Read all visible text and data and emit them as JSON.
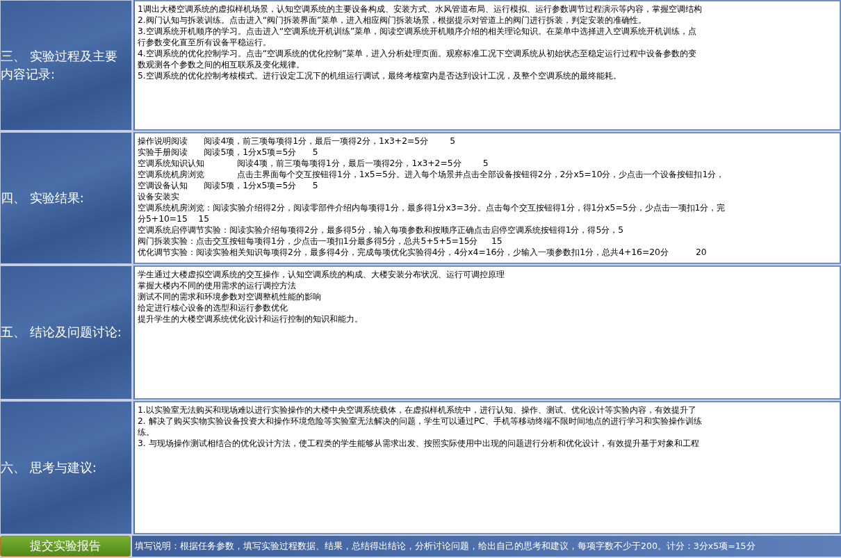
{
  "sections": [
    {
      "label": "三、 实验过程及主要内容记录:",
      "lines": [
        "1调出大楼空调系统的虚拟样机场景，认知空调系统的主要设备构成、安装方式、水风管道布局、运行模拟、运行参数调节过程演示等内容，掌握空调结构",
        "2.阀门认知与拆装训练。点击进入“阀门拆装界面”菜单，进入相应阀门拆装场景，根据提示对管道上的阀门进行拆装，判定安装的准确性。",
        "3.空调系统开机顺序的学习。点击进入“空调系统开机训练”菜单，阅读空调系统开机顺序介绍的相关理论知识。在菜单中选择进入空调系统开机训练，点",
        "行参数变化直至所有设备平稳运行。",
        "4.空调系统的优化控制学习。点击“空调系统的优化控制”菜单，进入分析处理页面。观察标准工况下空调系统从初始状态至稳定运行过程中设备参数的变",
        "数观测各个参数之间的相互联系及变化规律。",
        "5.空调系统的优化控制考核模式。进行设定工况下的机组运行调试，最终考核室内是否达到设计工况，及整个空调系统的最终能耗。"
      ]
    },
    {
      "label": "四、 实验结果:",
      "lines": [
        "操作说明阅读      阅读4项，前三项每项得1分，最后一项得2分，1x3+2=5分        5",
        "实验手册阅读      阅读5项，1分x5项=5分      5",
        "空调系统知识认知            阅读4项，前三项每项得1分，最后一项得2分，1x3+2=5分        5",
        "空调系统机房浏览            点击主界面每个交互按钮得1分，1x5=5分。进入每个场景并点击全部设备按钮得2分，2分x5=10分，少点击一个设备按钮扣1分，",
        "空调设备认知      阅读5项，1分x5项=5分      5",
        "设备安装实",
        "空调系统机房浏览：阅读实验介绍得2分，阅读零部件介绍内每项得1分，最多得1分x3=3分。点击每个交互按钮得1分，得1分x5=5分，少点击一项扣1分，完",
        "分5+10=15    15",
        "空调系统启停调节实验：阅读实验介绍每项得2分，最多得5分，输入每项参数和按顺序正确点击启停空调系统按钮得1分，得5分，5",
        "阀门拆装实验：点击交互按钮每项得1分，少点击一项扣1分最多得5分，总共5+5+5=15分     15",
        "优化调节实验：阅读实验相关知识每项得2分，最多得4分，完成每项优化实验得4分，4分x4=16分，少输入一项参数扣1分，总共4+16=20分          20"
      ]
    },
    {
      "label": "五、 结论及问题讨论:",
      "lines": [
        "学生通过大楼虚拟空调系统的交互操作，认知空调系统的构成、大楼安装分布状况、运行可调控原理",
        "掌握大楼内不同的使用需求的运行调控方法",
        "测试不同的需求和环境参数对空调整机性能的影响",
        "给定进行核心设备的选型和运行参数优化",
        "提升学生的大楼空调系统优化设计和运行控制的知识和能力。"
      ]
    },
    {
      "label": "六、 思考与建议:",
      "lines": [
        "1.以实验室无法购买和现场难以进行实验操作的大楼中央空调系统载体，在虚拟样机系统中，进行认知、操作、测试、优化设计等实验内容，有效提升了",
        "2. 解决了购买实物实验设备投资大和操作环境危险等实验室无法解决的问题，学生可以通过PC、手机等移动终端不限时间地点的进行学习和实验操作训练",
        "练。",
        "3. 与现场操作测试相结合的优化设计方法，使工程类的学生能够从需求出发、按照实际使用中出现的问题进行分析和优化设计，有效提升基于对象和工程"
      ]
    }
  ],
  "submit_button": "提交实验报告",
  "footer_note": "填写说明：根据任务参数，填写实验过程数据、结果，总结得出结论，分析讨论问题，给出自己的思考和建议，每项字数不少于200。计分：3分x5项=15分"
}
